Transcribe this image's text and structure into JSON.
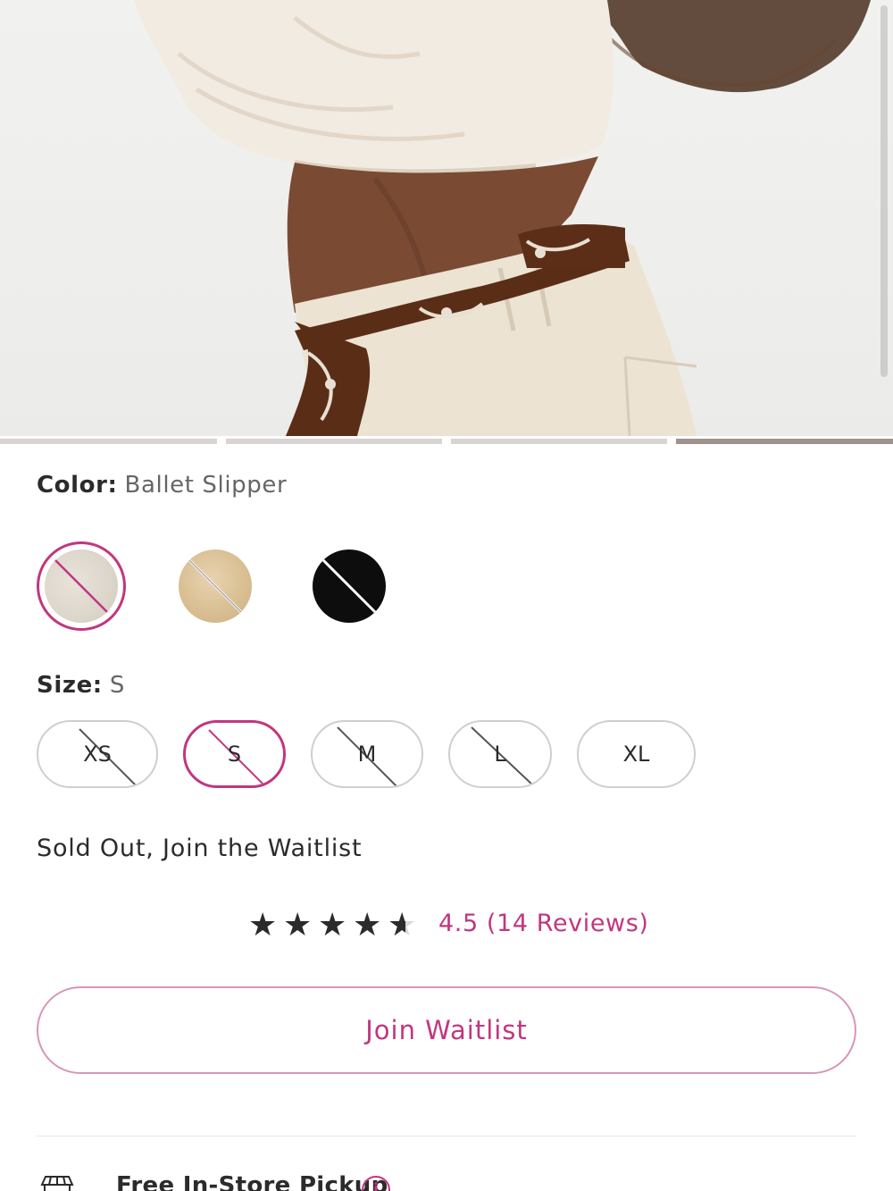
{
  "gallery": {
    "image_alt": "Model wearing cream cropped top and pants with brown bandana belt",
    "slide_count": 4,
    "active_slide": 4
  },
  "color": {
    "label": "Color:",
    "selected": "Ballet Slipper",
    "swatches": [
      {
        "name": "Ballet Slipper",
        "hex": "#dcd6cb",
        "unavailable": true,
        "selected": true
      },
      {
        "name": "Tan",
        "hex": "#d9bf93",
        "unavailable": true,
        "selected": false
      },
      {
        "name": "Black",
        "hex": "#0d0d0d",
        "unavailable": true,
        "selected": false
      }
    ]
  },
  "size": {
    "label": "Size:",
    "selected": "S",
    "options": [
      {
        "label": "XS",
        "unavailable": true
      },
      {
        "label": "S",
        "unavailable": true,
        "selected": true
      },
      {
        "label": "M",
        "unavailable": true
      },
      {
        "label": "L",
        "unavailable": true
      },
      {
        "label": "XL",
        "unavailable": false
      }
    ]
  },
  "status": {
    "text": "Sold Out, Join the Waitlist"
  },
  "rating": {
    "stars": 4.5,
    "max": 5,
    "link_text": "4.5 (14 Reviews)"
  },
  "waitlist_button": {
    "label": "Join Waitlist"
  },
  "pickup": {
    "title": "Free In-Store Pickup",
    "info_glyph": "i"
  },
  "colors": {
    "accent": "#c2367f",
    "text": "#2b2b2b",
    "muted": "#666666",
    "border": "#cfcfcf"
  }
}
